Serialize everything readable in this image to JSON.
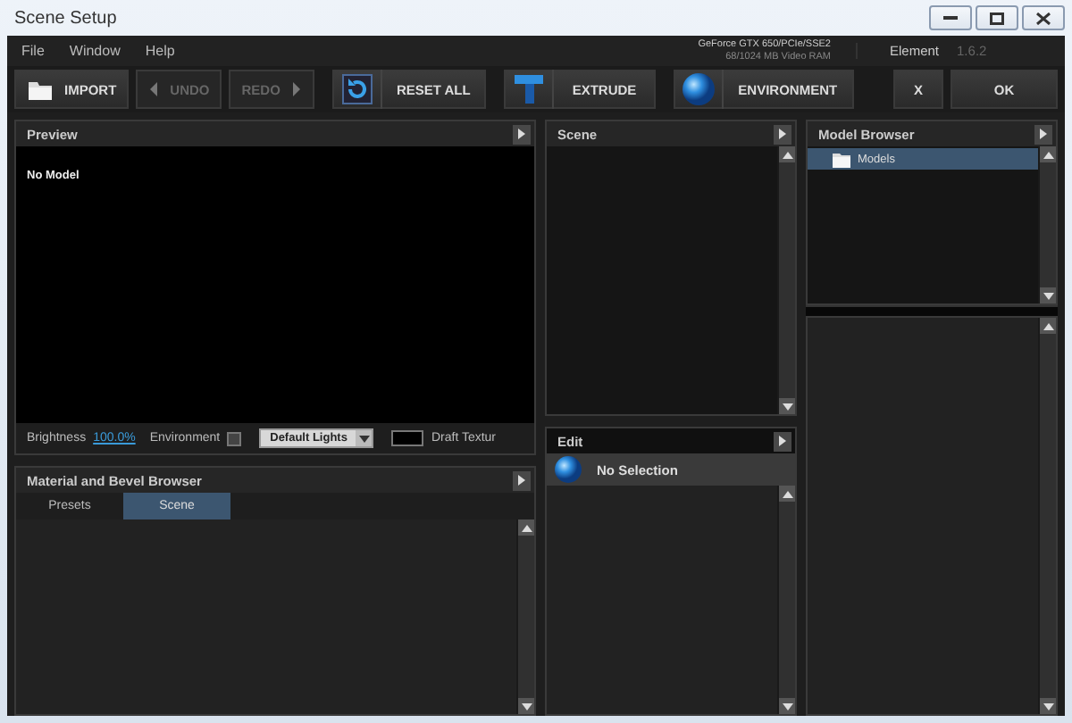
{
  "window": {
    "title": "Scene Setup"
  },
  "menu": [
    "File",
    "Window",
    "Help"
  ],
  "gpu_info": [
    "GeForce GTX 650/PCIe/SSE2",
    "68/1024 MB Video RAM"
  ],
  "app": {
    "name": "Element",
    "version": "1.6.2"
  },
  "toolbar": [
    {
      "kind": "import",
      "label": "IMPORT",
      "disabled": false
    },
    {
      "kind": "undo",
      "label": "UNDO",
      "disabled": true
    },
    {
      "kind": "redo",
      "label": "REDO",
      "disabled": true
    },
    {
      "kind": "reset",
      "label": "RESET ALL",
      "disabled": false
    },
    {
      "kind": "extrude",
      "label": "EXTRUDE",
      "disabled": false
    },
    {
      "kind": "environment",
      "label": "ENVIRONMENT",
      "disabled": false
    }
  ],
  "dialog_buttons": {
    "cancel": "X",
    "ok": "OK"
  },
  "preview": {
    "title": "Preview",
    "overlay": "No Model",
    "brightness_label": "Brightness",
    "brightness_value": "100.0%",
    "environment_label": "Environment",
    "environment_checked": false,
    "lights": "Default Lights",
    "draft_label": "Draft Textur"
  },
  "material_browser": {
    "title": "Material and Bevel Browser",
    "tabs": [
      {
        "label": "Presets",
        "selected": false
      },
      {
        "label": "Scene",
        "selected": true
      }
    ]
  },
  "scene": {
    "title": "Scene"
  },
  "edit": {
    "title": "Edit",
    "selection": "No Selection"
  },
  "model_browser": {
    "title": "Model Browser",
    "items": [
      {
        "label": "Models",
        "selected": true
      }
    ]
  }
}
